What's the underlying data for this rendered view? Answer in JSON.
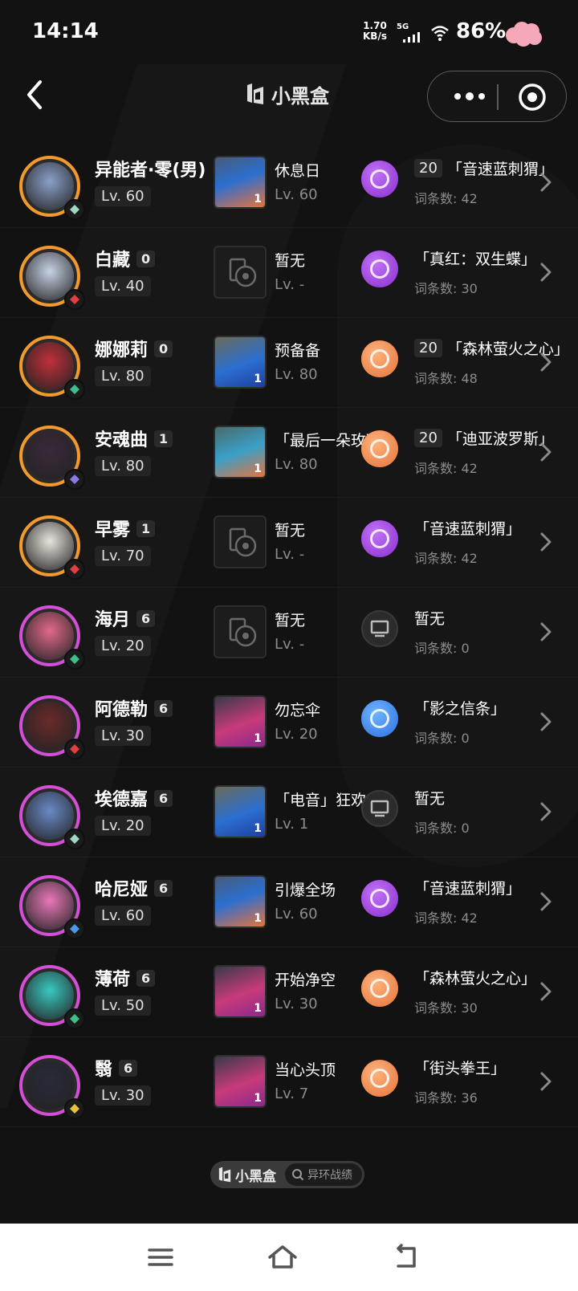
{
  "status_bar": {
    "time": "14:14",
    "net_speed": "1.70",
    "net_unit": "KB/s",
    "network": "5G",
    "battery": "86%"
  },
  "header": {
    "title": "小黑盒"
  },
  "characters": [
    {
      "name": "异能者·零(男)",
      "rank": "",
      "level": "Lv. 60",
      "border": "orange",
      "face": "#8aa0c8",
      "element_color": "#9fd6c6",
      "wengine": {
        "name": "休息日",
        "level": "Lv. 60",
        "count": "1",
        "bg": "orange",
        "empty": false
      },
      "disc": {
        "color": "purple",
        "pieces": "20",
        "set": "「音速蓝刺猬」",
        "entries": "词条数: 42"
      }
    },
    {
      "name": "白藏",
      "rank": "0",
      "level": "Lv. 40",
      "border": "orange",
      "face": "#c8d2e6",
      "element_color": "#e0413e",
      "wengine": {
        "name": "暂无",
        "level": "Lv. -",
        "count": "",
        "bg": "",
        "empty": true
      },
      "disc": {
        "color": "purple",
        "pieces": "",
        "set": "「真红：双生蝶」",
        "entries": "词条数: 30"
      }
    },
    {
      "name": "娜娜莉",
      "rank": "0",
      "level": "Lv. 80",
      "border": "orange",
      "face": "#c0303a",
      "element_color": "#3fbf8a",
      "wengine": {
        "name": "预备备",
        "level": "Lv. 80",
        "count": "1",
        "bg": "blue",
        "empty": false
      },
      "disc": {
        "color": "orange",
        "pieces": "20",
        "set": "「森林萤火之心」",
        "entries": "词条数: 48"
      }
    },
    {
      "name": "安魂曲",
      "rank": "1",
      "level": "Lv. 80",
      "border": "orange",
      "face": "#3a2a3a",
      "element_color": "#8a7ae8",
      "wengine": {
        "name": "「最后一朵玫瑰」",
        "level": "Lv. 80",
        "count": "1",
        "bg": "teal",
        "empty": false
      },
      "disc": {
        "color": "orange",
        "pieces": "20",
        "set": "「迪亚波罗斯」",
        "entries": "词条数: 42"
      }
    },
    {
      "name": "早雾",
      "rank": "1",
      "level": "Lv. 70",
      "border": "orange",
      "face": "#e8e4dc",
      "element_color": "#e0413e",
      "wengine": {
        "name": "暂无",
        "level": "Lv. -",
        "count": "",
        "bg": "",
        "empty": true
      },
      "disc": {
        "color": "purple",
        "pieces": "",
        "set": "「音速蓝刺猬」",
        "entries": "词条数: 42"
      }
    },
    {
      "name": "海月",
      "rank": "6",
      "level": "Lv. 20",
      "border": "purple",
      "face": "#e26a8a",
      "element_color": "#3fbf8a",
      "wengine": {
        "name": "暂无",
        "level": "Lv. -",
        "count": "",
        "bg": "",
        "empty": true
      },
      "disc": {
        "color": "gray",
        "pieces": "",
        "set": "暂无",
        "entries": "词条数: 0"
      }
    },
    {
      "name": "阿德勒",
      "rank": "6",
      "level": "Lv. 30",
      "border": "purple",
      "face": "#6a2a2a",
      "element_color": "#e0413e",
      "wengine": {
        "name": "勿忘伞",
        "level": "Lv. 20",
        "count": "1",
        "bg": "pink",
        "empty": false
      },
      "disc": {
        "color": "blue",
        "pieces": "",
        "set": "「影之信条」",
        "entries": "词条数: 0"
      }
    },
    {
      "name": "埃德嘉",
      "rank": "6",
      "level": "Lv. 20",
      "border": "purple",
      "face": "#6a8ac8",
      "element_color": "#9fd6c6",
      "wengine": {
        "name": "「电音」狂欢",
        "level": "Lv. 1",
        "count": "1",
        "bg": "blue",
        "empty": false
      },
      "disc": {
        "color": "gray",
        "pieces": "",
        "set": "暂无",
        "entries": "词条数: 0"
      }
    },
    {
      "name": "哈尼娅",
      "rank": "6",
      "level": "Lv. 60",
      "border": "purple",
      "face": "#e878b8",
      "element_color": "#4a9ae8",
      "wengine": {
        "name": "引爆全场",
        "level": "Lv. 60",
        "count": "1",
        "bg": "orange",
        "empty": false
      },
      "disc": {
        "color": "purple",
        "pieces": "",
        "set": "「音速蓝刺猬」",
        "entries": "词条数: 42"
      }
    },
    {
      "name": "薄荷",
      "rank": "6",
      "level": "Lv. 50",
      "border": "purple",
      "face": "#3ac8c0",
      "element_color": "#3fbf8a",
      "wengine": {
        "name": "开始净空",
        "level": "Lv. 30",
        "count": "1",
        "bg": "pink",
        "empty": false
      },
      "disc": {
        "color": "orange",
        "pieces": "",
        "set": "「森林萤火之心」",
        "entries": "词条数: 30"
      }
    },
    {
      "name": "翳",
      "rank": "6",
      "level": "Lv. 30",
      "border": "purple",
      "face": "#2a2a3a",
      "element_color": "#e8c23e",
      "wengine": {
        "name": "当心头顶",
        "level": "Lv. 7",
        "count": "1",
        "bg": "pink",
        "empty": false
      },
      "disc": {
        "color": "orange",
        "pieces": "",
        "set": "「街头拳王」",
        "entries": "词条数: 36"
      }
    }
  ],
  "footer": {
    "brand": "小黑盒",
    "section": "异环战绩"
  },
  "colors": {
    "background": "#121212",
    "rank_orange": "#f29a2e",
    "rank_purple": "#d24fd6"
  }
}
